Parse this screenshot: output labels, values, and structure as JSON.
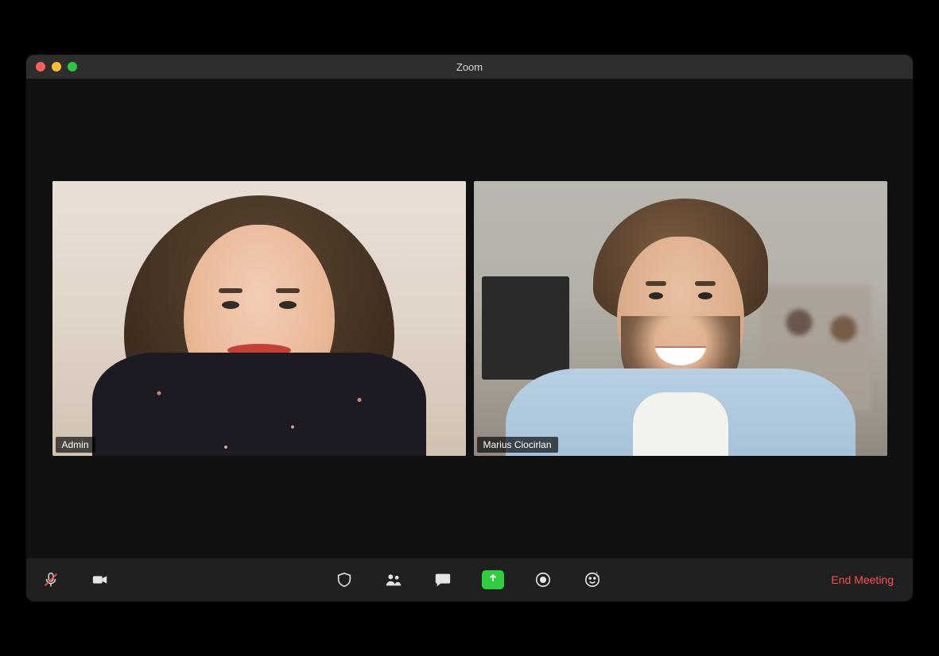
{
  "window": {
    "title": "Zoom"
  },
  "participants": [
    {
      "name": "Admin",
      "active_speaker": true
    },
    {
      "name": "Marius Ciocirlan",
      "active_speaker": false
    }
  ],
  "toolbar": {
    "mute_icon": "microphone-muted-icon",
    "video_icon": "video-camera-icon",
    "security_icon": "shield-icon",
    "participants_icon": "people-icon",
    "chat_icon": "chat-bubble-icon",
    "share_icon": "share-screen-icon",
    "record_icon": "record-icon",
    "reactions_icon": "reactions-icon",
    "end_label": "End Meeting"
  },
  "colors": {
    "active_border": "#b6e61e",
    "share_green": "#2ecc40",
    "end_red": "#ff4d4d"
  }
}
